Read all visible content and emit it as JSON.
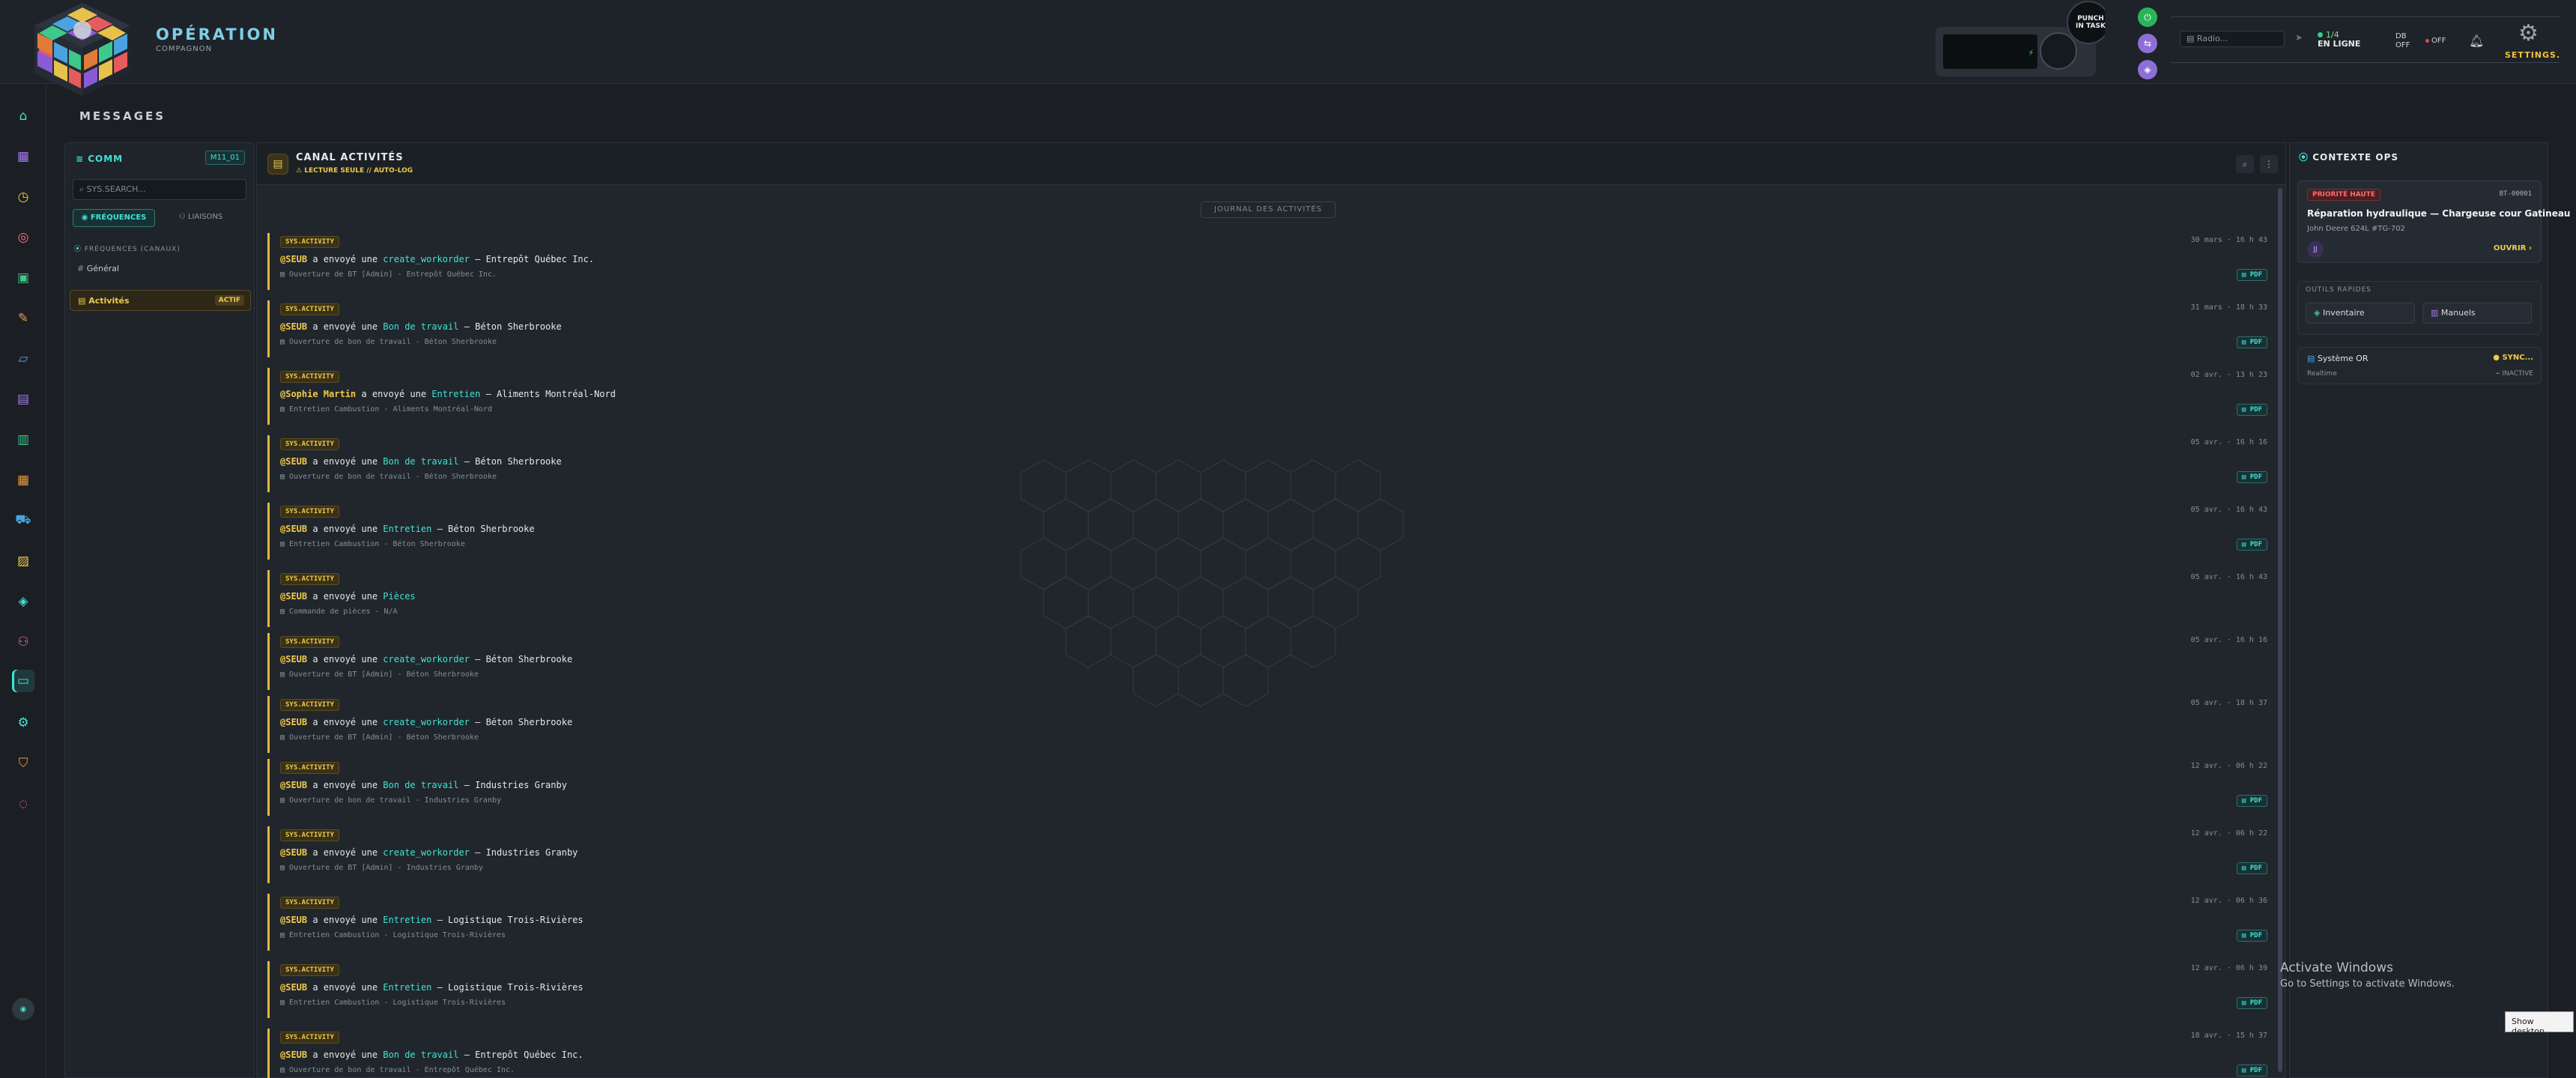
{
  "brand": {
    "title": "OPÉRATION",
    "subtitle": "COMPAGNON"
  },
  "header": {
    "punch_label": "PUNCH IN TASK",
    "radio_placeholder": "Radio...",
    "online_top": "1/4",
    "online_label": "EN LIGNE",
    "db_label": "DB OFF",
    "off_label": "OFF",
    "settings_label": "SETTINGS."
  },
  "page": {
    "title": "MESSAGES"
  },
  "comm": {
    "title": "COMM",
    "badge": "M11_01",
    "search_placeholder": "SYS.SEARCH...",
    "tab_freq": "FRÉQUENCES",
    "tab_liaisons": "LIAISONS",
    "section": "FRÉQUENCES (CANAUX)",
    "channels": [
      {
        "label": "Général",
        "badge": ""
      },
      {
        "label": "Activités",
        "badge": "ACTIF"
      }
    ]
  },
  "channel": {
    "title": "CANAL ACTIVITÉS",
    "subtitle": "LECTURE SEULE // AUTO-LOG",
    "journal": "JOURNAL DES ACTIVITÉS"
  },
  "messages": [
    {
      "tag": "SYS.ACTIVITY",
      "who": "@SEUB",
      "verb": "a envoyé une",
      "what": "create_workorder",
      "target": "— Entrepôt Québec Inc.",
      "sub": "Ouverture de BT [Admin] - Entrepôt Québec Inc.",
      "time": "30 mars · 16 h 43",
      "pdf": "PDF"
    },
    {
      "tag": "SYS.ACTIVITY",
      "who": "@SEUB",
      "verb": "a envoyé une",
      "what": "Bon de travail",
      "target": "— Béton Sherbrooke",
      "sub": "Ouverture de bon de travail - Béton Sherbrooke",
      "time": "31 mars · 18 h 33",
      "pdf": "PDF"
    },
    {
      "tag": "SYS.ACTIVITY",
      "who": "@Sophie Martin",
      "verb": "a envoyé une",
      "what": "Entretien",
      "target": "— Aliments Montréal-Nord",
      "sub": "Entretien Cambustion - Aliments Montréal-Nord",
      "time": "02 avr. · 13 h 23",
      "pdf": "PDF"
    },
    {
      "tag": "SYS.ACTIVITY",
      "who": "@SEUB",
      "verb": "a envoyé une",
      "what": "Bon de travail",
      "target": "— Béton Sherbrooke",
      "sub": "Ouverture de bon de travail - Béton Sherbrooke",
      "time": "05 avr. · 16 h 16",
      "pdf": "PDF"
    },
    {
      "tag": "SYS.ACTIVITY",
      "who": "@SEUB",
      "verb": "a envoyé une",
      "what": "Entretien",
      "target": "— Béton Sherbrooke",
      "sub": "Entretien Cambustion - Béton Sherbrooke",
      "time": "05 avr. · 16 h 43",
      "pdf": "PDF"
    },
    {
      "tag": "SYS.ACTIVITY",
      "who": "@SEUB",
      "verb": "a envoyé une",
      "what": "Pièces",
      "target": "",
      "sub": "Commande de pièces - N/A",
      "time": "05 avr. · 16 h 43",
      "pdf": ""
    },
    {
      "tag": "SYS.ACTIVITY",
      "who": "@SEUB",
      "verb": "a envoyé une",
      "what": "create_workorder",
      "target": "— Béton Sherbrooke",
      "sub": "Ouverture de BT [Admin] - Béton Sherbrooke",
      "time": "05 avr. · 16 h 16",
      "pdf": ""
    },
    {
      "tag": "SYS.ACTIVITY",
      "who": "@SEUB",
      "verb": "a envoyé une",
      "what": "create_workorder",
      "target": "— Béton Sherbrooke",
      "sub": "Ouverture de BT [Admin] - Béton Sherbrooke",
      "time": "05 avr. · 18 h 37",
      "pdf": ""
    },
    {
      "tag": "SYS.ACTIVITY",
      "who": "@SEUB",
      "verb": "a envoyé une",
      "what": "Bon de travail",
      "target": "— Industries Granby",
      "sub": "Ouverture de bon de travail - Industries Granby",
      "time": "12 avr. · 06 h 22",
      "pdf": "PDF"
    },
    {
      "tag": "SYS.ACTIVITY",
      "who": "@SEUB",
      "verb": "a envoyé une",
      "what": "create_workorder",
      "target": "— Industries Granby",
      "sub": "Ouverture de BT [Admin] - Industries Granby",
      "time": "12 avr. · 06 h 22",
      "pdf": "PDF"
    },
    {
      "tag": "SYS.ACTIVITY",
      "who": "@SEUB",
      "verb": "a envoyé une",
      "what": "Entretien",
      "target": "— Logistique Trois-Rivières",
      "sub": "Entretien Cambustion - Logistique Trois-Rivières",
      "time": "12 avr. · 06 h 36",
      "pdf": "PDF"
    },
    {
      "tag": "SYS.ACTIVITY",
      "who": "@SEUB",
      "verb": "a envoyé une",
      "what": "Entretien",
      "target": "— Logistique Trois-Rivières",
      "sub": "Entretien Cambustion - Logistique Trois-Rivières",
      "time": "12 avr. · 06 h 39",
      "pdf": "PDF"
    },
    {
      "tag": "SYS.ACTIVITY",
      "who": "@SEUB",
      "verb": "a envoyé une",
      "what": "Bon de travail",
      "target": "— Entrepôt Québec Inc.",
      "sub": "Ouverture de bon de travail - Entrepôt Québec Inc.",
      "time": "18 avr. · 15 h 37",
      "pdf": "PDF"
    }
  ],
  "context": {
    "title": "CONTEXTE OPS",
    "priority": "PRIORITÉ HAUTE",
    "id": "BT-00001",
    "job_title": "Réparation hydraulique — Chargeuse cour Gatineau",
    "job_sub": "John Deere 624L #TG-702",
    "avatar": "JJ",
    "open_label": "OUVRIR",
    "tools_label": "OUTILS RAPIDES",
    "tool_inventory": "Inventaire",
    "tool_manuals": "Manuels",
    "sys_name": "Système OR",
    "sys_sync": "SYNC...",
    "sys_rt": "Realtime",
    "sys_status": "INACTIVE"
  },
  "os": {
    "activate_title": "Activate Windows",
    "activate_sub": "Go to Settings to activate Windows.",
    "show_desktop": "Show desktop"
  },
  "colors": {
    "accent": "#3ee3d3",
    "highlight": "#f1c94b",
    "danger": "#ff6b6b"
  }
}
